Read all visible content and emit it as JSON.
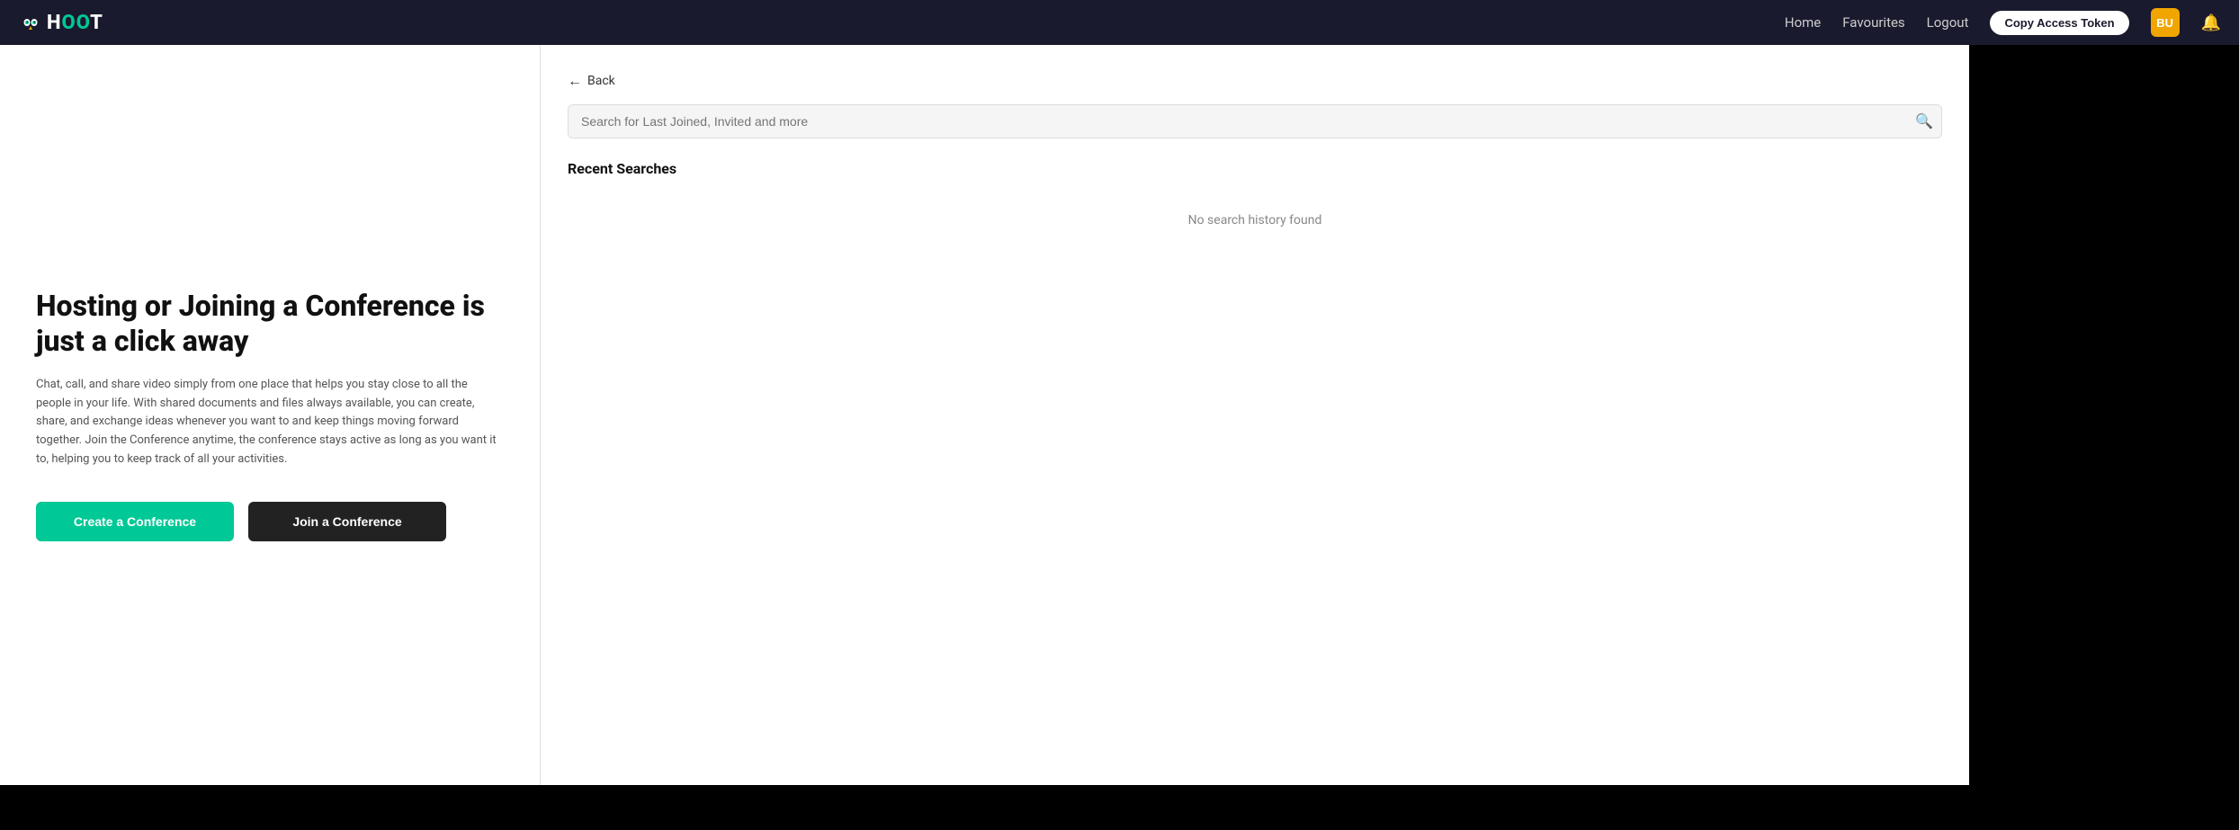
{
  "navbar": {
    "logo_text": "HOOT",
    "nav_links": [
      {
        "label": "Home",
        "key": "home"
      },
      {
        "label": "Favourites",
        "key": "favourites"
      },
      {
        "label": "Logout",
        "key": "logout"
      }
    ],
    "copy_token_label": "Copy Access Token",
    "avatar_initials": "BU",
    "bell_icon": "🔔"
  },
  "left_panel": {
    "hero_title": "Hosting or Joining a Conference is just a click away",
    "hero_description": "Chat, call, and share video simply from one place that helps you stay close to all the people in your life. With shared documents and files always available, you can create, share, and exchange ideas whenever you want to and keep things moving forward together. Join the Conference anytime, the conference stays active as long as you want it to, helping you to keep track of all your activities.",
    "create_button": "Create a Conference",
    "join_button": "Join a Conference"
  },
  "right_panel": {
    "back_label": "Back",
    "search_placeholder": "Search for Last Joined, Invited and more",
    "recent_searches_title": "Recent Searches",
    "no_history_text": "No search history found"
  }
}
